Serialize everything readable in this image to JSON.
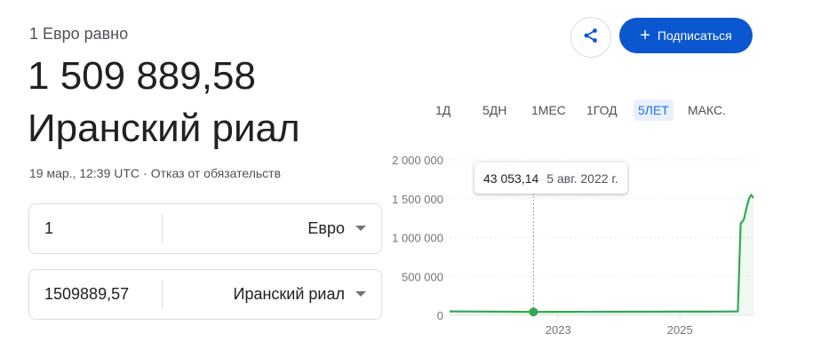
{
  "header": {
    "subtitle": "1 Евро равно",
    "amount": "1 509 889,58",
    "currency_name": "Иранский риал",
    "timestamp": "19 мар., 12:39 UTC",
    "separator": "·",
    "disclaimer": "Отказ от обязательств"
  },
  "converter": {
    "from_value": "1",
    "from_currency": "Евро",
    "to_value": "1509889,57",
    "to_currency": "Иранский риал"
  },
  "actions": {
    "share_icon": "share-icon",
    "subscribe_icon": "plus-icon",
    "subscribe_label": "Подписаться"
  },
  "ranges": [
    "1Д",
    "5ДН",
    "1МЕС",
    "1ГОД",
    "5ЛЕТ",
    "МАКС."
  ],
  "active_range": "5ЛЕТ",
  "tooltip": {
    "value": "43 053,14",
    "date": "5 авг. 2022 г."
  },
  "colors": {
    "accent": "#0b57d0",
    "line": "#34a853",
    "active_tab_bg": "#e8f0fe",
    "active_tab_text": "#1a73e8"
  },
  "chart_data": {
    "type": "line",
    "y_ticks": [
      0,
      500000,
      1000000,
      1500000,
      2000000
    ],
    "y_tick_labels": [
      "0",
      "500 000",
      "1 000 000",
      "1 500 000",
      "2 000 000"
    ],
    "x_ticks": [
      "2023",
      "2025"
    ],
    "ylim": [
      0,
      2000000
    ],
    "grid": true,
    "highlight_point": {
      "date": "2022-08-05",
      "value": 43053.14
    },
    "series": [
      {
        "points": [
          [
            "2021-03-19",
            50000
          ],
          [
            "2021-09-01",
            48000
          ],
          [
            "2022-03-01",
            46000
          ],
          [
            "2022-08-05",
            43053.14
          ],
          [
            "2022-12-01",
            44000
          ],
          [
            "2023-06-01",
            45000
          ],
          [
            "2024-01-01",
            46000
          ],
          [
            "2024-06-01",
            46000
          ],
          [
            "2025-01-01",
            47000
          ],
          [
            "2025-06-01",
            47000
          ],
          [
            "2025-10-01",
            48000
          ],
          [
            "2025-12-15",
            50000
          ],
          [
            "2026-01-01",
            1180000
          ],
          [
            "2026-01-20",
            1230000
          ],
          [
            "2026-02-05",
            1380000
          ],
          [
            "2026-02-20",
            1500000
          ],
          [
            "2026-03-05",
            1550000
          ],
          [
            "2026-03-19",
            1509889.58
          ]
        ]
      }
    ]
  }
}
